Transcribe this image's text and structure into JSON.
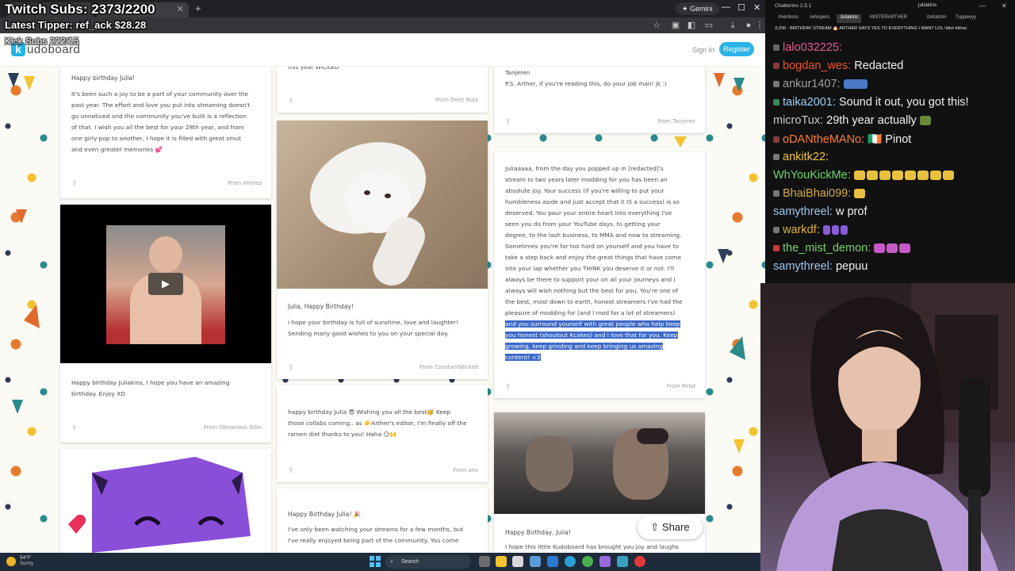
{
  "overlay": {
    "twitch_subs": "Twitch Subs: 2373/2200",
    "latest_tipper": "Latest Tipper: ref_ack  $28.28",
    "kick_subs": "Kick Subs 222/15"
  },
  "browser": {
    "tabs": [
      "",
      "",
      ""
    ],
    "gemini_label": "Gemini",
    "new_tab": "+",
    "minimize": "—",
    "maximize": "☐",
    "close": "✕"
  },
  "kudoboard": {
    "logo_letter": "k",
    "logo_text": "udoboard",
    "sign_in": "Sign In",
    "register": "Register",
    "share_label": "Share"
  },
  "cards": {
    "c1": {
      "greeting": "Happy birthday Julia!",
      "lines": [
        "It's been such a joy to be a part of your community over the",
        "past year. The effort and love you put into streaming doesn't",
        "go unnoticed and the community you've built is a reflection",
        "of that. I wish you all the best for your 28th year, and from",
        "one girly pop to another, I hope it is filled with great smut",
        "and even greater memories 💕"
      ],
      "from": "From Hmeez"
    },
    "c2": {
      "lines": [
        "Happy birthday Juliakins, I hope you have an amazing",
        "birthday. Enjoy XD"
      ],
      "from": "From Obnoxious Odin"
    },
    "c3": {
      "lines": [
        "this year WICKED"
      ],
      "from": "From Deez Nuts"
    },
    "c4": {
      "greeting": "Julia, Happy Birthday!",
      "lines": [
        "i hope your birthday is full of sunshine, love and laughter!",
        "Sending many good wishes to you on your special day."
      ],
      "from": "From ConstantWicked"
    },
    "c5": {
      "lines": [
        "happy birthday Julia 😎 Wishing you all the best🥳 Keep",
        "those collabs coming.. as 👉Arther's editor, I'm finally off the",
        "ramen diet thanks to you! Haha 😏🙌"
      ],
      "from": "From ano"
    },
    "c6": {
      "greeting": "Happy Birthday Julia! 🎉",
      "lines": [
        "I've only been watching your streams for a few months, but",
        "I've really enjoyed being part of the community. You come"
      ]
    },
    "c7": {
      "lines": [
        "Tanjeren",
        "",
        "P.S. Arther, if you're reading this, do your job man! jk :)"
      ],
      "from": "From Tanjeren"
    },
    "c8": {
      "lines": [
        "Juliaaaaa, from the day you popped up in [redacted]'s",
        "stream to two years later modding for you has been an",
        "absolute joy. Your success (if you're willing to put your",
        "humbleness aside and just accept that it IS a success) is so",
        "deserved. You pour your entire heart into everything I've",
        "seen you do from your YouTube days, to getting your",
        "degree, to the lash business, to MMA and now to streaming.",
        "Sometimes you're far too hard on yourself and you have to",
        "take a step back and enjoy the great things that have come",
        "into your lap whether you THINK you deserve it or not. I'll",
        "always be there to support your on all your journeys and I",
        "always will wish nothing but the best for you. You're one of",
        "the best, most down to earth, honest streamers I've had the",
        "pleasure of modding for (and I mod for a lot of streamers)"
      ],
      "highlighted": [
        "and you surround yourself with great people who help keep",
        "you honest (shoutout Kcakes) and I love that for you. Keep",
        "growing, keep grinding and keep bringing us amazing",
        "content! <3"
      ],
      "from": "From Pinot"
    },
    "c9": {
      "greeting": "Happy Birthday, Julia!",
      "lines": [
        "I hope this little Kudoboard has brought you joy and laughs"
      ]
    }
  },
  "chat": {
    "title": "Chatterino 2.5.1",
    "channel": "juliakins",
    "tabs": [
      "/mentions",
      "/whispers",
      "Juliakins",
      "MISTERARTHER",
      "itsKatchii",
      "Tuppeeyy"
    ],
    "banner": "3,206 · BIRTHDAY STREAM 🎂 ARTHER SAYS YES TO EVERYTHING I WANT LOL !idiot  follow",
    "messages": [
      {
        "user": "lalo032225:",
        "text": "",
        "color": "#e05a9a"
      },
      {
        "user": "bogdan_wes:",
        "text": "Redacted",
        "color": "#e8552a"
      },
      {
        "user": "ankur1407:",
        "text": "",
        "color": "#a0a0a0"
      },
      {
        "user": "taika2001:",
        "text": "Sound it out, you got this!",
        "color": "#9ad0f5"
      },
      {
        "user": "microTux:",
        "text": "29th year actually",
        "color": "#c8c8c8"
      },
      {
        "user": "oDANtheMANo:",
        "text": "🇮🇪 Pinot",
        "color": "#ff7d3a"
      },
      {
        "user": "ankitk22:",
        "text": "",
        "color": "#f4c542"
      },
      {
        "user": "WhYouKickMe:",
        "text": "",
        "color": "#6fd46a"
      },
      {
        "user": "BhaiBhai099:",
        "text": "",
        "color": "#d4a84a"
      },
      {
        "user": "samythreel:",
        "text": "w prof",
        "color": "#9bc6f0"
      },
      {
        "user": "warkdf:",
        "text": "",
        "color": "#e0b040"
      },
      {
        "user": "the_mist_demon:",
        "text": "",
        "color": "#7ad06a"
      },
      {
        "user": "samythreel:",
        "text": "pepuu",
        "color": "#9bc6f0"
      }
    ]
  },
  "taskbar": {
    "temp": "54°F",
    "weather": "Sunny",
    "search": "Search"
  }
}
